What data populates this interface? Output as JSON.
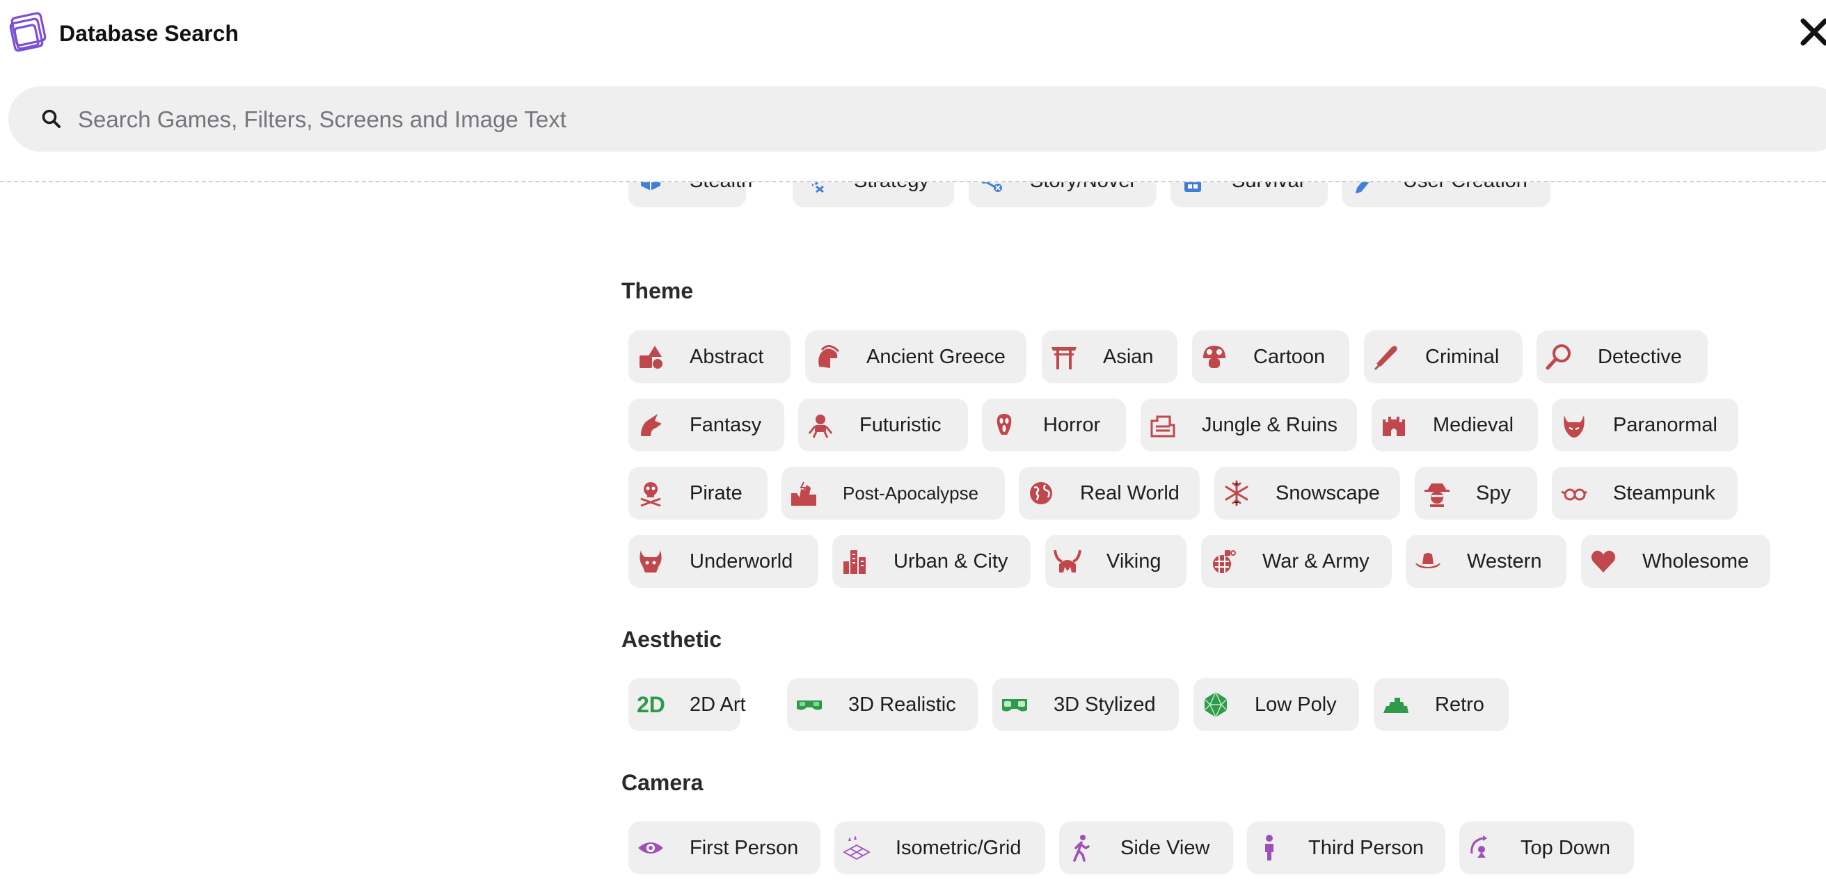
{
  "app": {
    "title": "Database Search"
  },
  "search": {
    "placeholder": "Search Games, Filters, Screens and Image Text",
    "value": ""
  },
  "colors": {
    "theme": "#c0474b",
    "gameplay": "#3d7fd9",
    "aesthetic": "#2f9a4a",
    "camera": "#a04fb8"
  },
  "gameplay": {
    "items": [
      {
        "label": "Stealth",
        "icon": "stealth-icon"
      },
      {
        "label": "Strategy",
        "icon": "strategy-icon"
      },
      {
        "label": "Story/Novel",
        "icon": "story-icon"
      },
      {
        "label": "Survival",
        "icon": "survival-icon"
      },
      {
        "label": "User Creation",
        "icon": "user-creation-icon"
      }
    ]
  },
  "theme": {
    "heading": "Theme",
    "items": [
      {
        "label": "Abstract",
        "icon": "abstract-icon"
      },
      {
        "label": "Ancient Greece",
        "icon": "spartan-helmet-icon"
      },
      {
        "label": "Asian",
        "icon": "torii-gate-icon"
      },
      {
        "label": "Cartoon",
        "icon": "mushroom-icon"
      },
      {
        "label": "Criminal",
        "icon": "baseball-bat-icon"
      },
      {
        "label": "Detective",
        "icon": "magnifier-icon"
      },
      {
        "label": "Fantasy",
        "icon": "dragon-icon"
      },
      {
        "label": "Futuristic",
        "icon": "robot-icon"
      },
      {
        "label": "Horror",
        "icon": "scream-mask-icon"
      },
      {
        "label": "Jungle & Ruins",
        "icon": "ruins-icon"
      },
      {
        "label": "Medieval",
        "icon": "castle-icon"
      },
      {
        "label": "Paranormal",
        "icon": "demon-icon"
      },
      {
        "label": "Pirate",
        "icon": "skull-crossbones-icon"
      },
      {
        "label": "Post-Apocalypse",
        "icon": "ruined-city-icon"
      },
      {
        "label": "Real World",
        "icon": "globe-icon"
      },
      {
        "label": "Snowscape",
        "icon": "snowflake-icon"
      },
      {
        "label": "Spy",
        "icon": "spy-icon"
      },
      {
        "label": "Steampunk",
        "icon": "goggles-icon"
      },
      {
        "label": "Underworld",
        "icon": "devil-icon"
      },
      {
        "label": "Urban & City",
        "icon": "city-icon"
      },
      {
        "label": "Viking",
        "icon": "viking-helmet-icon"
      },
      {
        "label": "War & Army",
        "icon": "grenade-icon"
      },
      {
        "label": "Western",
        "icon": "cowboy-hat-icon"
      },
      {
        "label": "Wholesome",
        "icon": "heart-icon"
      }
    ]
  },
  "aesthetic": {
    "heading": "Aesthetic",
    "items": [
      {
        "label": "2D Art",
        "icon": "2d-icon",
        "icon_text": "2D"
      },
      {
        "label": "3D Realistic",
        "icon": "3d-glasses-icon"
      },
      {
        "label": "3D Stylized",
        "icon": "3d-glasses-stylized-icon"
      },
      {
        "label": "Low Poly",
        "icon": "low-poly-icon"
      },
      {
        "label": "Retro",
        "icon": "retro-icon"
      }
    ]
  },
  "camera": {
    "heading": "Camera",
    "items": [
      {
        "label": "First Person",
        "icon": "eye-icon"
      },
      {
        "label": "Isometric/Grid",
        "icon": "isometric-grid-icon"
      },
      {
        "label": "Side View",
        "icon": "walking-figure-icon"
      },
      {
        "label": "Third Person",
        "icon": "figure-icon"
      },
      {
        "label": "Top Down",
        "icon": "top-down-icon"
      }
    ]
  }
}
